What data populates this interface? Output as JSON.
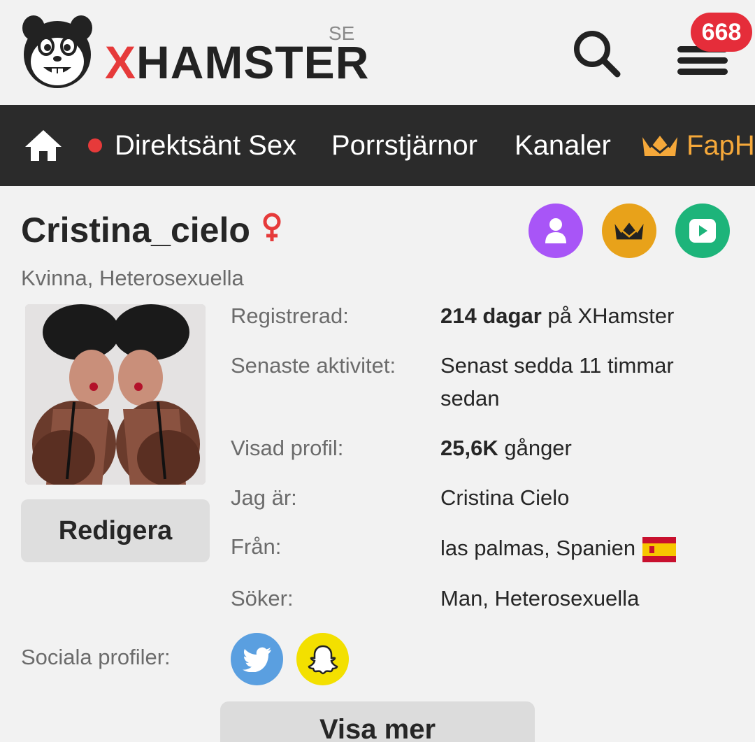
{
  "header": {
    "logo_text_x": "X",
    "logo_text_rest": "HAMSTER",
    "region": "SE",
    "notification_count": "668"
  },
  "nav": {
    "items": [
      {
        "label": "Direktsänt Sex"
      },
      {
        "label": "Porrstjärnor"
      },
      {
        "label": "Kanaler"
      },
      {
        "label": "FapH"
      }
    ]
  },
  "profile": {
    "username": "Cristina_cielo",
    "gender_icon": "female-symbol-icon",
    "subtitle": "Kvinna, Heterosexuella",
    "edit_label": "Redigera",
    "info": [
      {
        "label": "Registrerad:",
        "value_bold": "214 dagar",
        "value_rest": " på XHamster"
      },
      {
        "label": "Senaste aktivitet:",
        "value_line1": "Senast sedda 11 timmar",
        "value_line2": "sedan"
      },
      {
        "label": "Visad profil:",
        "value_bold": "25,6K",
        "value_rest": " gånger"
      },
      {
        "label": "Jag är:",
        "value": "Cristina Cielo"
      },
      {
        "label": "Från:",
        "value": "las palmas, Spanien"
      },
      {
        "label": "Söker:",
        "value": "Man, Heterosexuella"
      }
    ],
    "social_label": "Sociala profiler:",
    "show_more_label": "Visa mer"
  },
  "colors": {
    "accent_red": "#e63a3a",
    "nav_bg": "#2b2b2b",
    "premium_gold": "#f5a83a",
    "purple": "#a855f7",
    "gold": "#e8a21a",
    "green": "#1db47a",
    "twitter_blue": "#5a9fe0",
    "snapchat_yellow": "#f3e000"
  }
}
